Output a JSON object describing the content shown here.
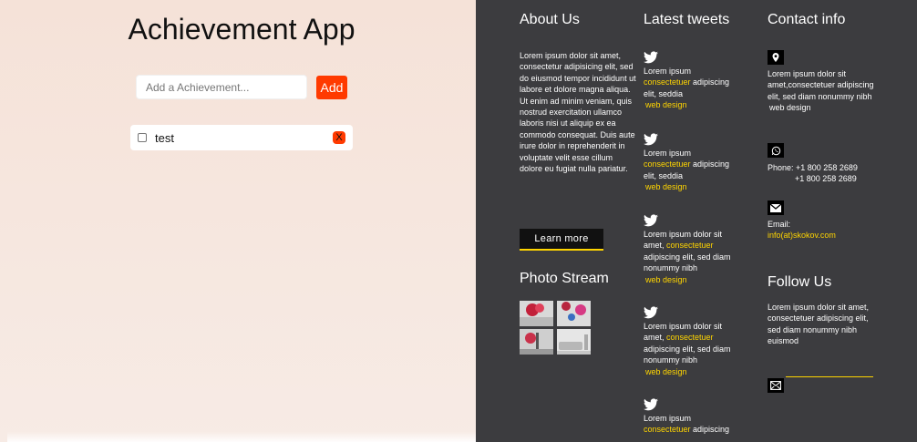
{
  "app": {
    "title": "Achievement App",
    "input_placeholder": "Add a Achievement...",
    "add_label": "Add",
    "items": [
      {
        "text": "test",
        "delete_label": "X"
      }
    ]
  },
  "about": {
    "heading": "About Us",
    "text": "Lorem ipsum dolor sit amet, consectetur adipisicing elit, sed do eiusmod tempor incididunt ut labore et dolore magna aliqua. Ut enim ad minim veniam, quis nostrud exercitation ullamco laboris nisi ut aliquip ex ea commodo consequat. Duis aute irure dolor in reprehenderit in voluptate velit esse cillum dolore eu fugiat nulla pariatur.",
    "button": "Learn more"
  },
  "photo_stream": {
    "heading": "Photo Stream"
  },
  "tweets": {
    "heading": "Latest tweets",
    "items": [
      {
        "pre": "Lorem ipsum ",
        "highlight": "consectetuer",
        "post": " adipiscing elit, seddia",
        "link": "web design"
      },
      {
        "pre": "Lorem ipsum ",
        "highlight": "consectetuer",
        "post": " adipiscing elit, seddia",
        "link": "web design"
      },
      {
        "pre": "Lorem ipsum dolor sit amet, ",
        "highlight": "consectetuer",
        "post": " adipiscing elit, sed diam nonummy nibh",
        "link": "web design"
      },
      {
        "pre": "Lorem ipsum dolor sit amet, ",
        "highlight": "consectetuer",
        "post": " adipiscing elit, sed diam nonummy nibh",
        "link": "web design"
      },
      {
        "pre": "Lorem ipsum ",
        "highlight": "consectetuer",
        "post": " adipiscing",
        "link": ""
      }
    ]
  },
  "contact": {
    "heading": "Contact info",
    "address": "Lorem ipsum dolor sit amet,consectetuer adipiscing elit, sed diam nonummy nibh",
    "address_link": "web design",
    "phone_label": "Phone: +1 800 258 2689",
    "phone_2": "+1 800 258 2689",
    "email_label": "Email:",
    "email": "info(at)skokov.com"
  },
  "follow": {
    "heading": "Follow Us",
    "text": "Lorem ipsum dolor sit amet, consectetuer adipiscing elit, sed diam nonummy nibh euismod"
  }
}
